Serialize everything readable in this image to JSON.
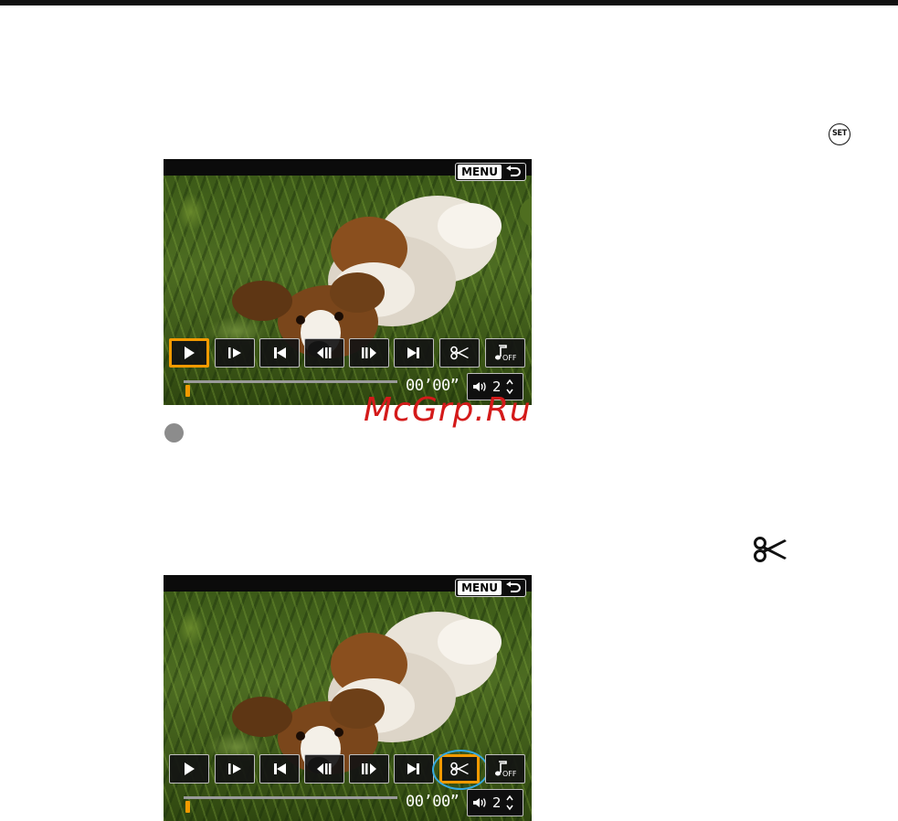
{
  "header_icon": "set-button-icon",
  "step_icon": "scissors-icon",
  "watermark": "McGrp.Ru",
  "screens": [
    {
      "menu_label": "MENU",
      "time": "00’00”",
      "volume": "2",
      "selected_control": "play",
      "highlighted_control": "",
      "progress": 0
    },
    {
      "menu_label": "MENU",
      "time": "00’00”",
      "volume": "2",
      "selected_control": "cut",
      "highlighted_control": "cut",
      "progress": 0
    }
  ],
  "set_label": "SET",
  "controls": [
    "play-button",
    "slow-motion-button",
    "first-frame-button",
    "previous-frame-button",
    "next-frame-button",
    "last-frame-button",
    "edit-cut-button",
    "background-music-button"
  ],
  "colors": {
    "selection": "#f39a00",
    "highlight_ring": "#34a9e0",
    "watermark": "#d41a1a"
  }
}
